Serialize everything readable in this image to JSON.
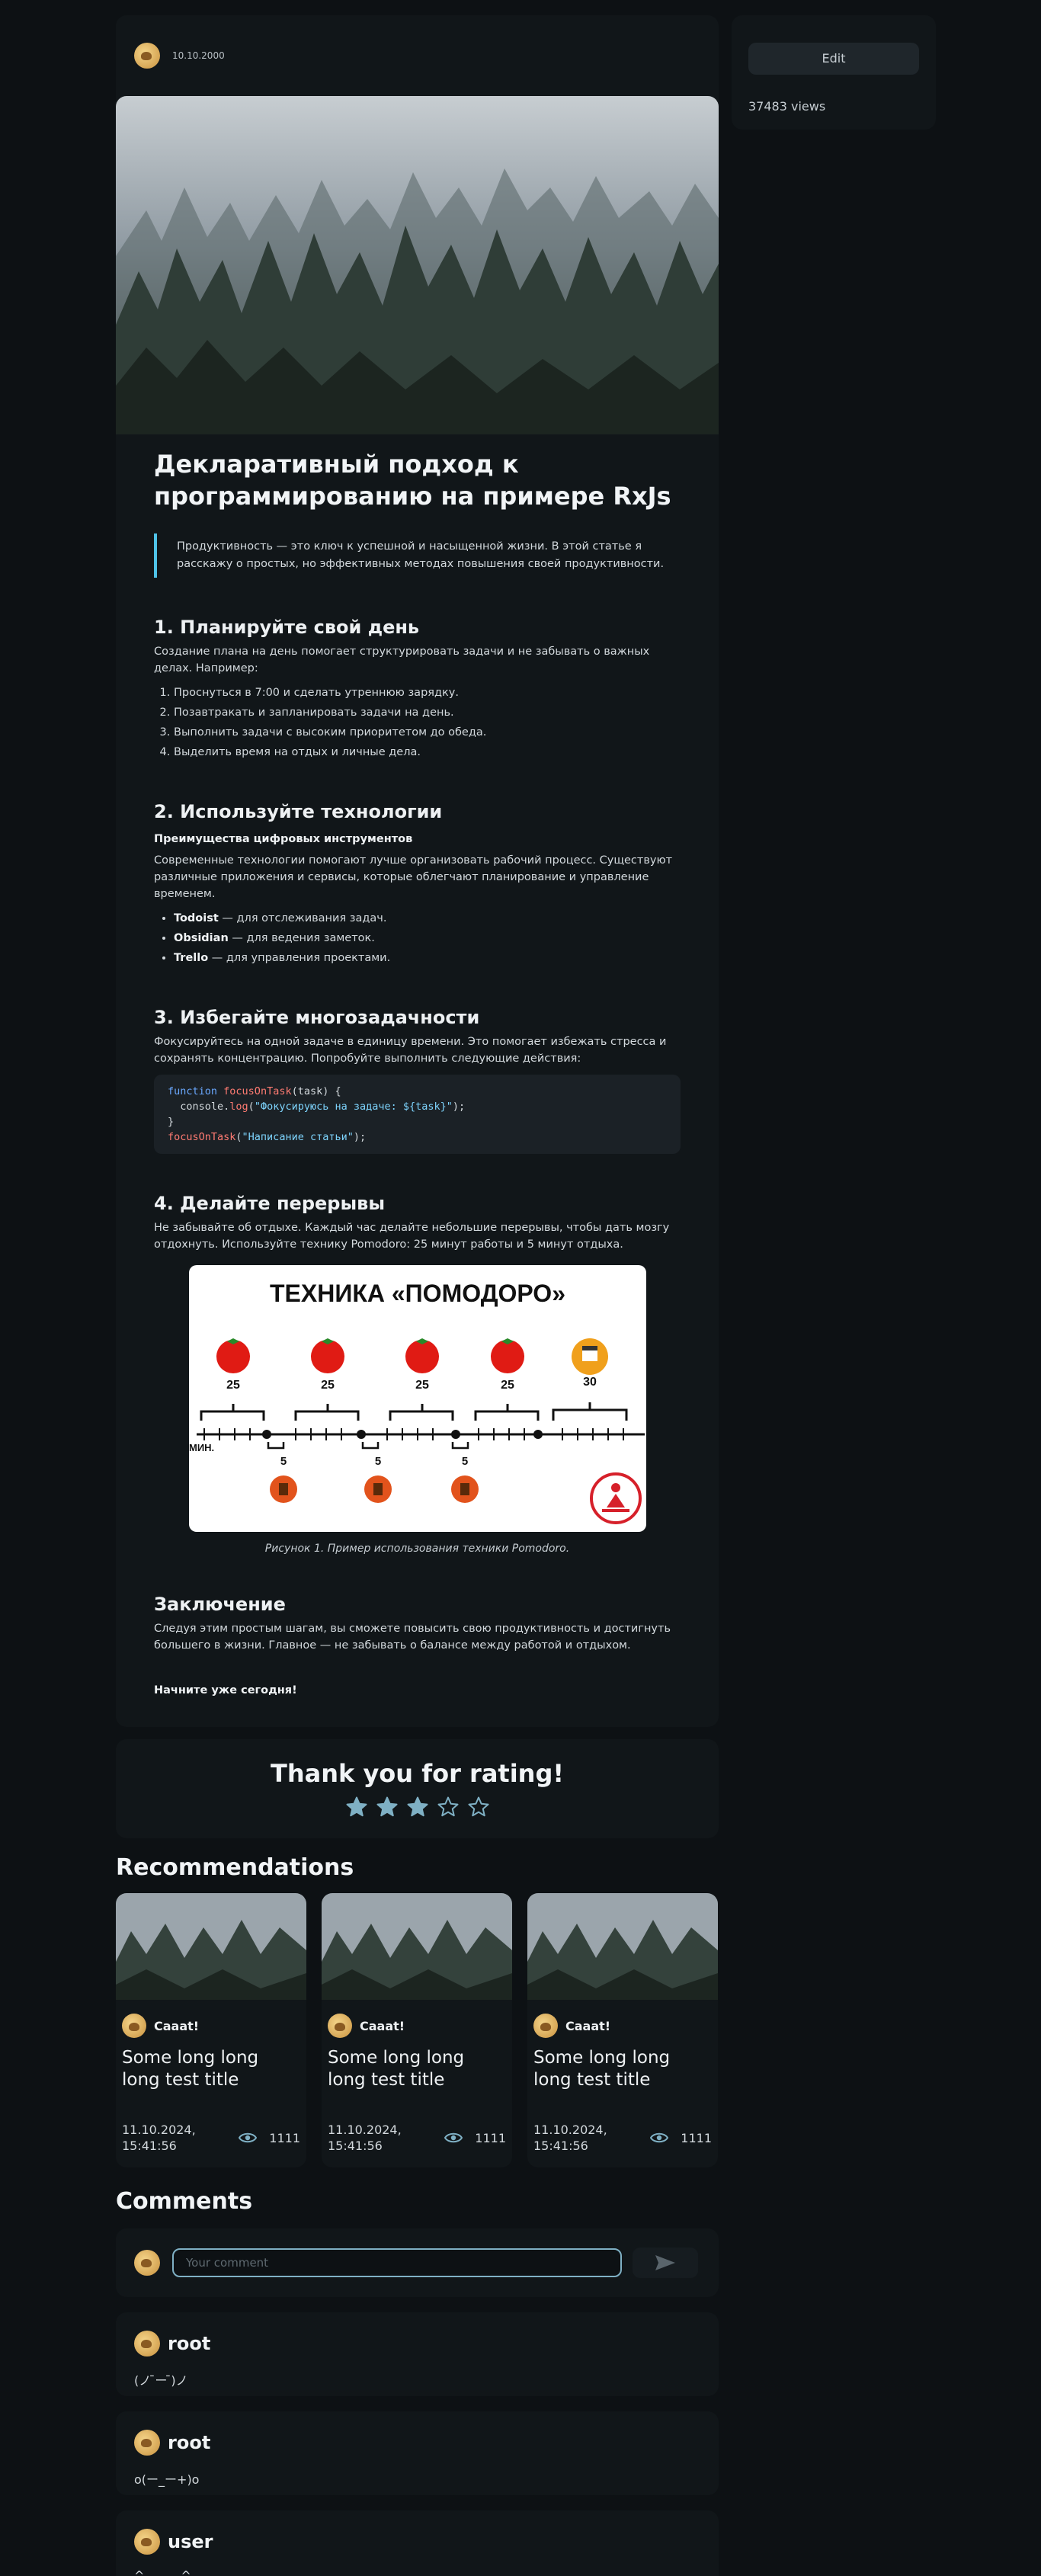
{
  "sidebar": {
    "edit_label": "Edit",
    "views": "37483 views"
  },
  "article": {
    "date": "10.10.2000",
    "title": "Декларативный подход к программированию на примере RxJs",
    "quote": "Продуктивность — это ключ к успешной и насыщенной жизни. В этой статье я расскажу о простых, но эффективных методах повышения своей продуктивности.",
    "s1": {
      "heading": "1. Планируйте свой день",
      "text": "Создание плана на день помогает структурировать задачи и не забывать о важных делах. Например:",
      "items": [
        "Проснуться в 7:00 и сделать утреннюю зарядку.",
        "Позавтракать и запланировать задачи на день.",
        "Выполнить задачи с высоким приоритетом до обеда.",
        "Выделить время на отдых и личные дела."
      ]
    },
    "s2": {
      "heading": "2. Используйте технологии",
      "subheading": "Преимущества цифровых инструментов",
      "text": "Современные технологии помогают лучше организовать рабочий процесс. Существуют различные приложения и сервисы, которые облегчают планирование и управление временем.",
      "items": [
        {
          "b": "Todoist",
          "t": " — для отслеживания задач."
        },
        {
          "b": "Obsidian",
          "t": " — для ведения заметок."
        },
        {
          "b": "Trello",
          "t": " — для управления проектами."
        }
      ]
    },
    "s3": {
      "heading": "3. Избегайте многозадачности",
      "text": "Фокусируйтесь на одной задаче в единицу времени. Это помогает избежать стресса и сохранять концентрацию. Попробуйте выполнить следующие действия:",
      "code": {
        "l1_kw": "function",
        "l1_fn": "focusOnTask",
        "l1_rest": "(task) {",
        "l2_a": "  console.",
        "l2_fn": "log",
        "l2_b": "(",
        "l2_str": "\"Фокусируюсь на задаче: ${task}\"",
        "l2_c": ");",
        "l3": "}",
        "l4_fn": "focusOnTask",
        "l4_a": "(",
        "l4_str": "\"Написание статьи\"",
        "l4_b": ");"
      }
    },
    "s4": {
      "heading": "4. Делайте перерывы",
      "text": "Не забывайте об отдыхе. Каждый час делайте небольшие перерывы, чтобы дать мозгу отдохнуть. Используйте технику Pomodoro: 25 минут работы и 5 минут отдыха.",
      "figure": {
        "title": "ТЕХНИКА «ПОМОДОРО»",
        "work": [
          "25",
          "25",
          "25",
          "25",
          "30"
        ],
        "rest": [
          "5",
          "5",
          "5"
        ],
        "unit": "МИН."
      },
      "caption": "Рисунок 1. Пример использования техники Pomodoro."
    },
    "conclusion": {
      "heading": "Заключение",
      "text": "Следуя этим простым шагам, вы сможете повысить свою продуктивность и достигнуть большего в жизни. Главное — не забывать о балансе между работой и отдыхом.",
      "final": "Начните уже сегодня!"
    }
  },
  "rating": {
    "title": "Thank you for rating!",
    "value": 3,
    "max": 5,
    "color": "#7fb0c4"
  },
  "recommendations": {
    "heading": "Recommendations",
    "cards": [
      {
        "user": "Caaat!",
        "title": "Some long long long test title",
        "date": "11.10.2024, 15:41:56",
        "views": "1111"
      },
      {
        "user": "Caaat!",
        "title": "Some long long long test title",
        "date": "11.10.2024, 15:41:56",
        "views": "1111"
      },
      {
        "user": "Caaat!",
        "title": "Some long long long test title",
        "date": "11.10.2024, 15:41:56",
        "views": "1111"
      }
    ]
  },
  "comments": {
    "heading": "Comments",
    "placeholder": "Your comment",
    "items": [
      {
        "user": "root",
        "text": "(ノ ̄ー ̄)ノ"
      },
      {
        "user": "root",
        "text": "o(ー_ー+)o"
      },
      {
        "user": "user",
        "text": "^______^"
      }
    ]
  }
}
